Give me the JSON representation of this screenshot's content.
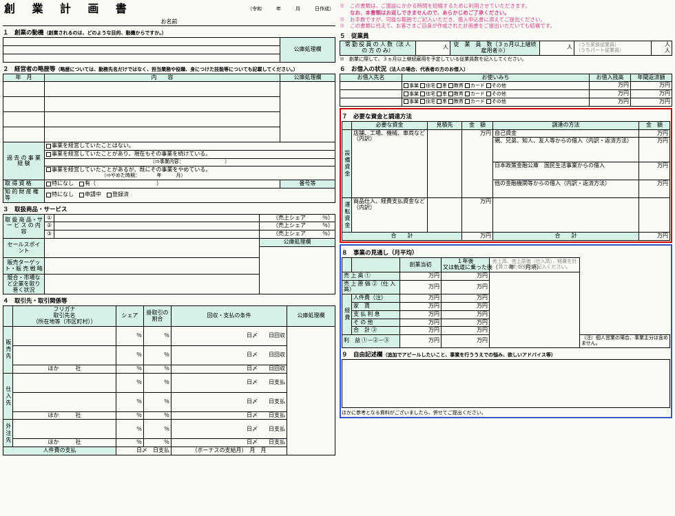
{
  "title": "創 業 計 画 書",
  "date_label": "（令和　　　年　　　月　　　日作成）",
  "name_label": "お名前",
  "sec1": {
    "h": "１　創業の動機",
    "note": "（創業されるのは、どのような目的、動機からですか。）",
    "col": "公庫処理欄"
  },
  "sec2": {
    "h": "２　経営者の略歴等",
    "note": "（略歴については、勤務先名だけではなく、担当業務や役職、身につけた技能等についても記載してください。）",
    "ym": "年　月",
    "naiyo": "内　　容",
    "col": "公庫処理欄"
  },
  "past": {
    "lbl": "過 去 の 事 業 経 験",
    "c1": "事業を経営していたことはない。",
    "c2a": "事業を経営していたことがあり、現在もその事業を続けている。",
    "c2b": "（⇒事業内容：　　　　　　　　　）",
    "c3a": "事業を経営していたことがあるが、既にその事業をやめている。",
    "c3b": "（⇒やめた時期：　　　　年　　　月）"
  },
  "qual": {
    "lbl": "取 得 資 格",
    "tn": "特になし",
    "ari": "有（　　　　　　　　　　　）",
    "bango": "番号等"
  },
  "ip": {
    "lbl": "知 的 財 産 権 等",
    "tn": "特になし",
    "sc": "申請中",
    "toroku": "登録済"
  },
  "sec3": {
    "h": "３　取扱商品・サービス",
    "r1": "取 扱 商 品・サ ー ビ ス の 内 容",
    "n1": "①",
    "n2": "②",
    "n3": "③",
    "share": "（売上シェア　　　％）",
    "sp": "セールスポイント",
    "tgt": "販売ターゲット・販 売 戦 略",
    "env": "競合・市場など企業を取り巻く状況",
    "col": "公庫処理欄"
  },
  "sec4": {
    "h": "４　取引先・取引関係等",
    "c1": "フリガナ\n取引先名\n（所在地等（市区町村））",
    "c2": "シェア",
    "c3": "掛取引の割合",
    "c4": "回収・支払の条件",
    "c5": "公庫処理欄",
    "hanbai": "販売先",
    "shiire": "仕入先",
    "gaichu": "外注先",
    "hoka": "ほか　　　社",
    "pct": "％",
    "nisime": "日〆",
    "nikaishu": "日回収",
    "nishiharai": "日支払",
    "jin": "人件費の支払",
    "bonus": "（ボーナスの支給月）",
    "tsuki": "月"
  },
  "right_notes": {
    "l1": "※　この書類は、ご面談にかかる時間を短縮するために利用させていただきます。",
    "l2b": "なお、本書類はお返しできませんので、あらかじめご了承ください。",
    "l3": "※　お手数ですが、可能な範囲でご記入いただき、借入申込書に添えてご提出ください。",
    "l4": "※　この書類に代えて、お客さまご自身が作成された計画書をご提出いただいても結構です。"
  },
  "sec5": {
    "h": "５　従業員",
    "a": "常 勤 役 員 の 人 数（法 人 の 方 の み）",
    "p": "人",
    "b": "従　業　員　数（３ヵ月以上継続雇用者※）",
    "f1": "（うち家族従業員）",
    "f2": "（うちパート従業員）",
    "note": "※　創業に際して、３ヵ月以上継続雇用を予定している従業員数を記入してください。"
  },
  "sec6": {
    "h": "６　お借入の状況",
    "note": "（法人の場合、代表者の方のお借入）",
    "c1": "お借入先名",
    "c2": "お使いみち",
    "c3": "お借入残高",
    "c4": "年間返済額",
    "opts": [
      "事業",
      "住宅",
      "車",
      "教育",
      "カード",
      "その他"
    ],
    "yen": "万円"
  },
  "sec7": {
    "h": "７　必要な資金と調達方法",
    "c1": "必要な資金",
    "c2": "見積先",
    "c3": "金　額",
    "c4": "調達の方法",
    "c5": "金　額",
    "setsubi": "設備資金",
    "unten": "運転資金",
    "r1": "店舗、工場、機械、車両など（内訳）",
    "r2": "商品仕入、経費支払資金など（内訳）",
    "d1": "自己資金",
    "d2": "親、兄弟、知人、友人等からの借入（内訳・返済方法）",
    "d3": "日本政策金融公庫　国民生活事業からの借入",
    "d4": "他の金融機関等からの借入（内訳・返済方法）",
    "gokei": "合　　計",
    "yen": "万円"
  },
  "sec8": {
    "h": "８　事業の見通し（月平均）",
    "c1": "創業当初",
    "c2": "１年後\n又は軌道に乗った後（　　年　　月頃）",
    "c3note": "売上高、売上原価（仕入高）、経費を計算された根拠をご記入ください。",
    "r1": "売 上 高 ①",
    "r2": "売 上 原 価 ②（仕 入 高）",
    "r31": "人件費（注）",
    "r32": "家　賃",
    "keihi": "経費",
    "r33": "支 払 利 息",
    "r34": "そ の 他",
    "r35": "合　計 ③",
    "r4": "利　益 ①－②－③",
    "note": "（注）個人営業の場合、事業主分は含めません。",
    "yen": "万円"
  },
  "sec9": {
    "h": "９　自由記述欄",
    "note": "（追加でアピールしたいこと、事業を行ううえでの悩み、欲しいアドバイス等）",
    "foot": "ほかに参考となる資料がございましたら、併せてご提出ください。"
  }
}
